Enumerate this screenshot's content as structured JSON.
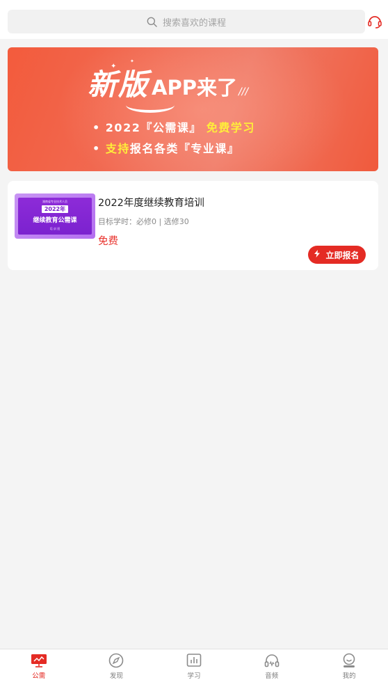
{
  "search": {
    "placeholder": "搜索喜欢的课程"
  },
  "header": {
    "service_icon": "headset-icon"
  },
  "banner": {
    "title_big": "新版",
    "title_mid": "APP来了",
    "title_deco": "///",
    "line1_prefix": "• 2022『公需课』",
    "line1_highlight": "免费学习",
    "line2_prefix": "•",
    "line2_highlight": "支持",
    "line2_suffix": "报名各类『专业课』"
  },
  "course": {
    "thumb_top": "湖南省专业技术人员",
    "thumb_year": "2022年",
    "thumb_main": "继续教育公需课",
    "thumb_bottom": "培 训 班",
    "title": "2022年度继续教育培训",
    "meta": "目标学时：必修0 | 选修30",
    "price": "免费",
    "enroll_label": "立即报名"
  },
  "tabbar": {
    "items": [
      {
        "label": "公需",
        "icon": "public-course-icon",
        "active": true
      },
      {
        "label": "发现",
        "icon": "compass-icon",
        "active": false
      },
      {
        "label": "学习",
        "icon": "study-chart-icon",
        "active": false
      },
      {
        "label": "音频",
        "icon": "headphones-icon",
        "active": false
      },
      {
        "label": "我的",
        "icon": "profile-icon",
        "active": false
      }
    ]
  },
  "colors": {
    "accent": "#e42b24",
    "price": "#e8302a",
    "banner_highlight": "#ffee3a"
  }
}
